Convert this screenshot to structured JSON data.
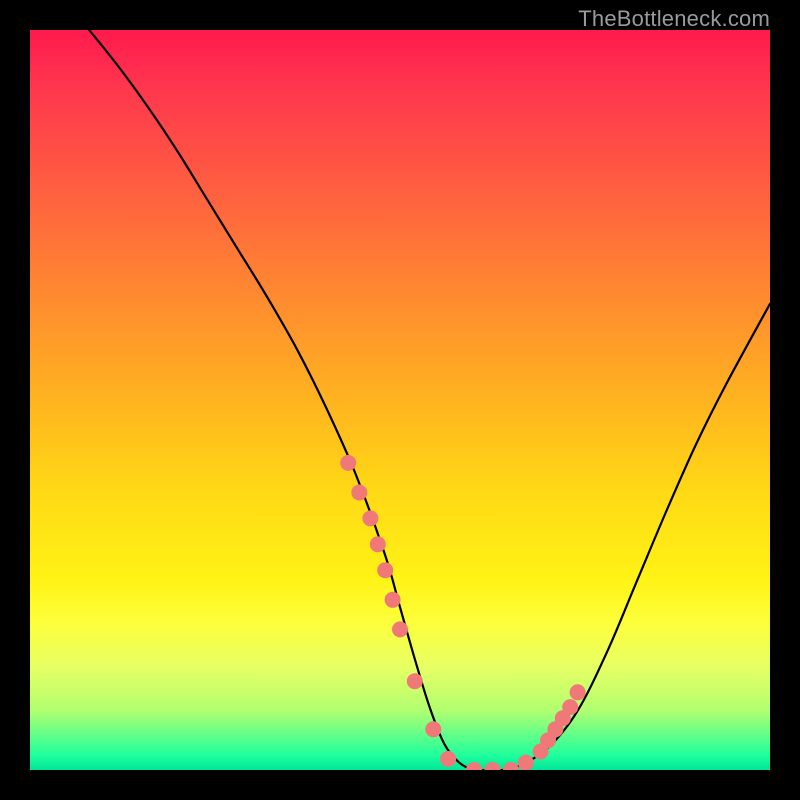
{
  "watermark": "TheBottleneck.com",
  "chart_data": {
    "type": "line",
    "title": "",
    "xlabel": "",
    "ylabel": "",
    "xlim": [
      0,
      100
    ],
    "ylim": [
      0,
      100
    ],
    "series": [
      {
        "name": "bottleneck-curve",
        "x": [
          8,
          12,
          16,
          20,
          24,
          28,
          32,
          36,
          40,
          44,
          48,
          50,
          52,
          54,
          56,
          58,
          60,
          62,
          64,
          66,
          70,
          74,
          78,
          82,
          86,
          90,
          94,
          100
        ],
        "values": [
          100,
          95,
          89.5,
          83.5,
          77,
          70.5,
          64,
          57,
          49,
          40,
          29,
          22,
          15,
          8.5,
          3.5,
          1,
          0,
          0,
          0,
          0.5,
          3,
          8,
          16,
          25.5,
          35,
          44,
          52,
          63
        ]
      }
    ],
    "markers": {
      "name": "highlight-dots",
      "color": "#f07878",
      "x": [
        43,
        44.5,
        46,
        47,
        48,
        49,
        50,
        52,
        54.5,
        56.5,
        60,
        62.5,
        65,
        67,
        69,
        70,
        71,
        72,
        73,
        74
      ],
      "values": [
        41.5,
        37.5,
        34,
        30.5,
        27,
        23,
        19,
        12,
        5.5,
        1.5,
        0,
        0,
        0,
        1,
        2.5,
        4,
        5.5,
        7,
        8.5,
        10.5
      ]
    },
    "background_gradient": {
      "top": "#ff1a4d",
      "mid": "#ffd815",
      "bottom": "#00e69a"
    }
  }
}
